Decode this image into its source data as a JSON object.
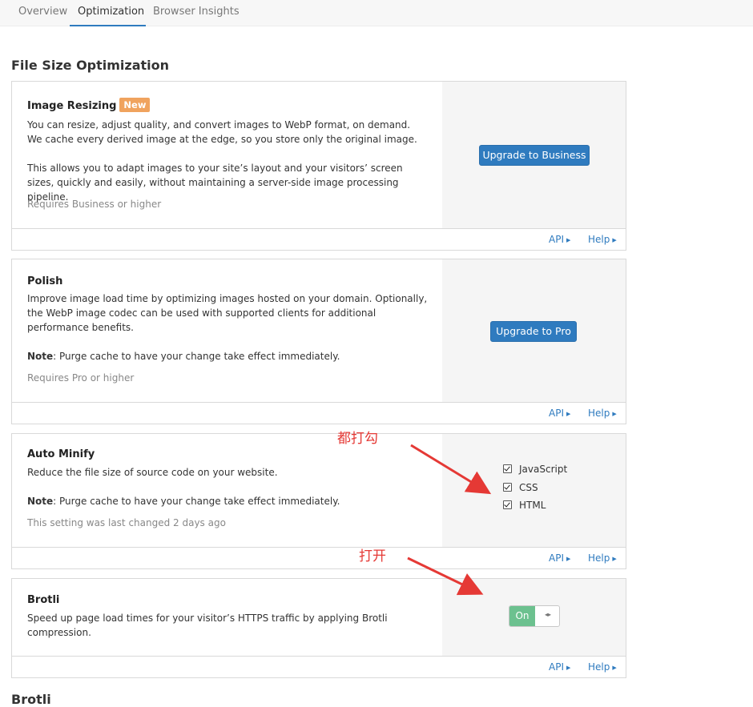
{
  "tabs": [
    {
      "label": "Overview"
    },
    {
      "label": "Optimization"
    },
    {
      "label": "Browser Insights"
    }
  ],
  "section_title": "File Size Optimization",
  "footer": {
    "api_label": "API",
    "help_label": "Help"
  },
  "cards": {
    "image_resizing": {
      "title": "Image Resizing",
      "badge": "New",
      "desc1": "You can resize, adjust quality, and convert images to WebP format, on demand. We cache every derived image at the edge, so you store only the original image.",
      "desc2": "This allows you to adapt images to your site’s layout and your visitors’ screen sizes, quickly and easily, without maintaining a server-side image processing pipeline.",
      "requirement": "Requires Business or higher",
      "button": "Upgrade to Business"
    },
    "polish": {
      "title": "Polish",
      "desc": "Improve image load time by optimizing images hosted on your domain. Optionally, the WebP image codec can be used with supported clients for additional performance benefits.",
      "note_label": "Note",
      "note_text": ": Purge cache to have your change take effect immediately.",
      "requirement": "Requires Pro or higher",
      "button": "Upgrade to Pro"
    },
    "auto_minify": {
      "title": "Auto Minify",
      "desc": "Reduce the file size of source code on your website.",
      "note_label": "Note",
      "note_text": ": Purge cache to have your change take effect immediately.",
      "changed": "This setting was last changed 2 days ago",
      "options": [
        {
          "label": "JavaScript",
          "checked": true
        },
        {
          "label": "CSS",
          "checked": true
        },
        {
          "label": "HTML",
          "checked": true
        }
      ]
    },
    "brotli": {
      "title": "Brotli",
      "desc": "Speed up page load times for your visitor’s HTTPS traffic by applying Brotli compression.",
      "toggle_label": "On",
      "toggle_on": true
    }
  },
  "annotations": {
    "check_all": "都打勾",
    "turn_on": "打开"
  },
  "next_section_partial": "Brotli",
  "colors": {
    "accent": "#2f7bbf",
    "badge": "#f0a35e",
    "toggle_on": "#6cc18f",
    "annotation": "#e53935"
  }
}
